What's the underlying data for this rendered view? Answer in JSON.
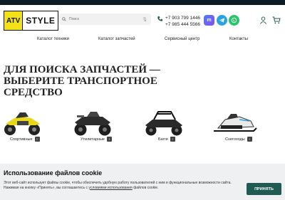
{
  "logo": {
    "part1": "ATV",
    "part2": "STYLE"
  },
  "search": {
    "placeholder": "Поиск"
  },
  "contacts": {
    "phone1": "+7 903 799 1446",
    "phone2": "+7 985 444 5566"
  },
  "social": {
    "max": "max-messenger-icon",
    "telegram": "telegram-icon",
    "whatsapp": "whatsapp-icon"
  },
  "nav": {
    "items": [
      {
        "label": "Каталог техники"
      },
      {
        "label": "Каталог запчастей"
      },
      {
        "label": "Сервисный центр"
      },
      {
        "label": "Контакты"
      }
    ]
  },
  "headline": "Для поиска запчастей — выберите транспортное средство",
  "vehicles": [
    {
      "label": "Спортивные",
      "icon": "sport-atv-icon"
    },
    {
      "label": "Утилитарные",
      "icon": "utility-atv-icon"
    },
    {
      "label": "Багги",
      "icon": "buggy-icon"
    },
    {
      "label": "Снегоходы",
      "icon": "snowmobile-icon"
    }
  ],
  "cookie": {
    "title": "Использование файлов cookie",
    "text": "Этот веб-сайт использует файлы cookie, чтобы обеспечить удобную работу пользователей с ним и функциональные возможности сайта. Нажимая на кнопку «Принять», вы соглашаетесь с",
    "link": "условиями использования",
    "text_end": "файлов cookie.",
    "accept_label": "Принять"
  },
  "colors": {
    "topbar": "#0d1b24",
    "logo_yellow": "#f3e21a",
    "accept": "#1f5a53",
    "cookie_bg": "#eef0f1"
  }
}
